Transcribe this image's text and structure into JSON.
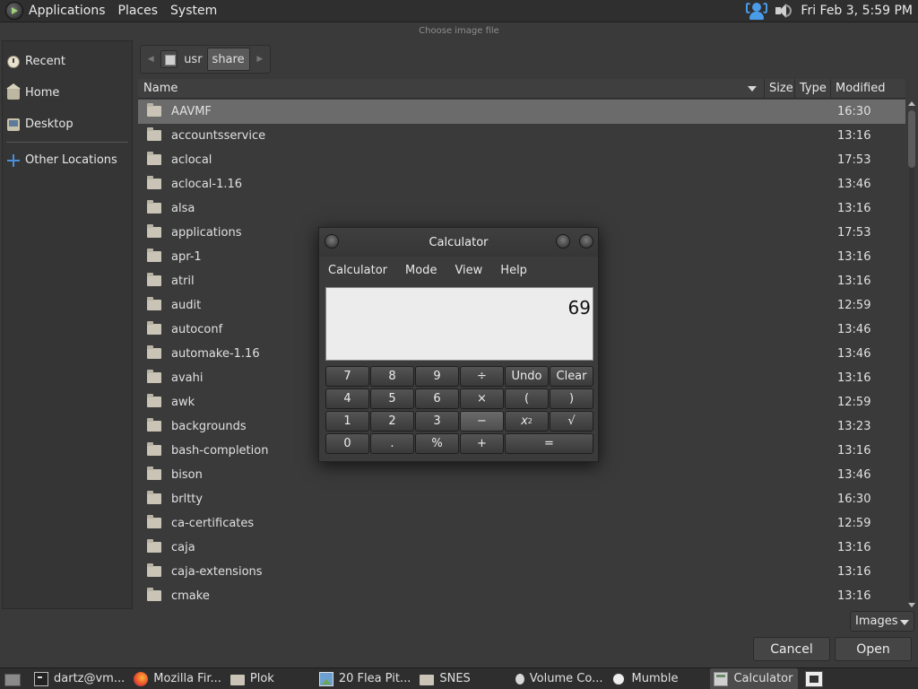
{
  "top_panel": {
    "menus": [
      "Applications",
      "Places",
      "System"
    ],
    "clock": "Fri Feb  3,  5:59 PM"
  },
  "dialog": {
    "title": "Choose image file",
    "filter_label": "Images",
    "cancel_label": "Cancel",
    "open_label": "Open"
  },
  "sidebar": {
    "items": [
      {
        "label": "Recent",
        "icon": "recent-icon"
      },
      {
        "label": "Home",
        "icon": "home-icon"
      },
      {
        "label": "Desktop",
        "icon": "desktop-icon"
      },
      {
        "label": "Other Locations",
        "icon": "plus-icon"
      }
    ]
  },
  "pathbar": {
    "segments": [
      "usr",
      "share"
    ]
  },
  "file_list": {
    "columns": {
      "name": "Name",
      "size": "Size",
      "type": "Type",
      "modified": "Modified"
    },
    "rows": [
      {
        "name": "AAVMF",
        "modified": "16:30"
      },
      {
        "name": "accountsservice",
        "modified": "13:16"
      },
      {
        "name": "aclocal",
        "modified": "17:53"
      },
      {
        "name": "aclocal-1.16",
        "modified": "13:46"
      },
      {
        "name": "alsa",
        "modified": "13:16"
      },
      {
        "name": "applications",
        "modified": "17:53"
      },
      {
        "name": "apr-1",
        "modified": "13:16"
      },
      {
        "name": "atril",
        "modified": "13:16"
      },
      {
        "name": "audit",
        "modified": "12:59"
      },
      {
        "name": "autoconf",
        "modified": "13:46"
      },
      {
        "name": "automake-1.16",
        "modified": "13:46"
      },
      {
        "name": "avahi",
        "modified": "13:16"
      },
      {
        "name": "awk",
        "modified": "12:59"
      },
      {
        "name": "backgrounds",
        "modified": "13:23"
      },
      {
        "name": "bash-completion",
        "modified": "13:16"
      },
      {
        "name": "bison",
        "modified": "13:46"
      },
      {
        "name": "brltty",
        "modified": "16:30"
      },
      {
        "name": "ca-certificates",
        "modified": "12:59"
      },
      {
        "name": "caja",
        "modified": "13:16"
      },
      {
        "name": "caja-extensions",
        "modified": "13:16"
      },
      {
        "name": "cmake",
        "modified": "13:16"
      }
    ]
  },
  "calculator": {
    "title": "Calculator",
    "menus": [
      "Calculator",
      "Mode",
      "View",
      "Help"
    ],
    "display": "69",
    "keys": {
      "k7": "7",
      "k8": "8",
      "k9": "9",
      "div": "÷",
      "undo": "Undo",
      "clear": "Clear",
      "k4": "4",
      "k5": "5",
      "k6": "6",
      "mul": "×",
      "lparen": "(",
      "rparen": ")",
      "k1": "1",
      "k2": "2",
      "k3": "3",
      "sub": "−",
      "pow_base": "x",
      "pow_exp": "2",
      "sqrt": "√",
      "k0": "0",
      "dot": ".",
      "pct": "%",
      "add": "+",
      "eq": "="
    }
  },
  "taskbar": {
    "tasks": [
      "dartz@vm...",
      "Mozilla Fir...",
      "Plok",
      "20 Flea Pit...",
      "SNES",
      "Volume Co...",
      "Mumble",
      "Calculator"
    ]
  }
}
